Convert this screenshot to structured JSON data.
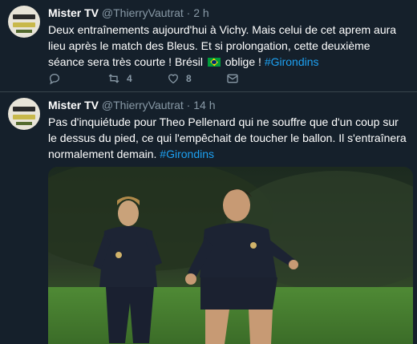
{
  "tweets": [
    {
      "name": "Mister TV",
      "handle": "@ThierryVautrat",
      "time": "2 h",
      "text_before_flag": "Deux entraînements aujourd'hui à Vichy. Mais celui de cet aprem aura lieu après le match des Bleus. Et si prolongation, cette deuxième séance sera très courte ! Brésil",
      "text_after_flag": " oblige ! ",
      "hashtag": "#Girondins",
      "flag_icon": "brazil-flag-icon",
      "actions": {
        "reply_count": "",
        "retweet_count": "4",
        "like_count": "8"
      }
    },
    {
      "name": "Mister TV",
      "handle": "@ThierryVautrat",
      "time": "14 h",
      "text": "Pas d'inquiétude pour Theo Pellenard qui ne souffre que d'un coup sur le dessus du pied, ce qui l'empêchait de toucher le ballon. Il s'entraînera normalement demain. ",
      "hashtag": "#Girondins",
      "media": "photo-two-players-training"
    }
  ],
  "colors": {
    "background": "#15202b",
    "secondary_text": "#8899a6",
    "link": "#1da1f2",
    "divider": "#38444d"
  }
}
